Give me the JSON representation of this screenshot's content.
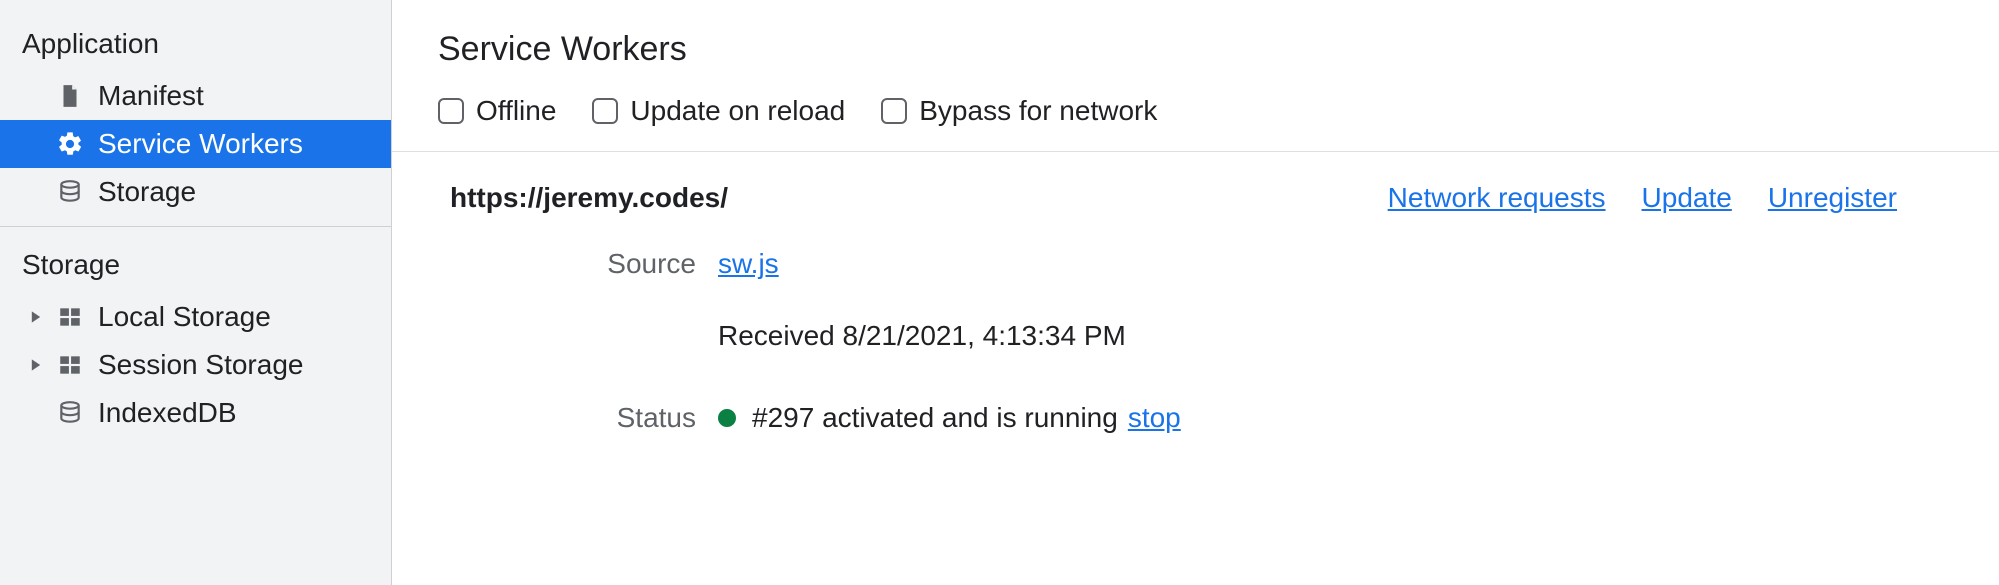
{
  "sidebar": {
    "sections": {
      "application": {
        "title": "Application",
        "items": [
          {
            "label": "Manifest"
          },
          {
            "label": "Service Workers"
          },
          {
            "label": "Storage"
          }
        ]
      },
      "storage": {
        "title": "Storage",
        "items": [
          {
            "label": "Local Storage"
          },
          {
            "label": "Session Storage"
          },
          {
            "label": "IndexedDB"
          }
        ]
      }
    }
  },
  "main": {
    "title": "Service Workers",
    "checkboxes": {
      "offline": "Offline",
      "update_on_reload": "Update on reload",
      "bypass_for_network": "Bypass for network"
    },
    "origin": "https://jeremy.codes/",
    "actions": {
      "network_requests": "Network requests",
      "update": "Update",
      "unregister": "Unregister"
    },
    "labels": {
      "source": "Source",
      "status": "Status"
    },
    "source": {
      "file": "sw.js",
      "received": "Received 8/21/2021, 4:13:34 PM"
    },
    "status": {
      "text": "#297 activated and is running",
      "stop": "stop"
    }
  }
}
